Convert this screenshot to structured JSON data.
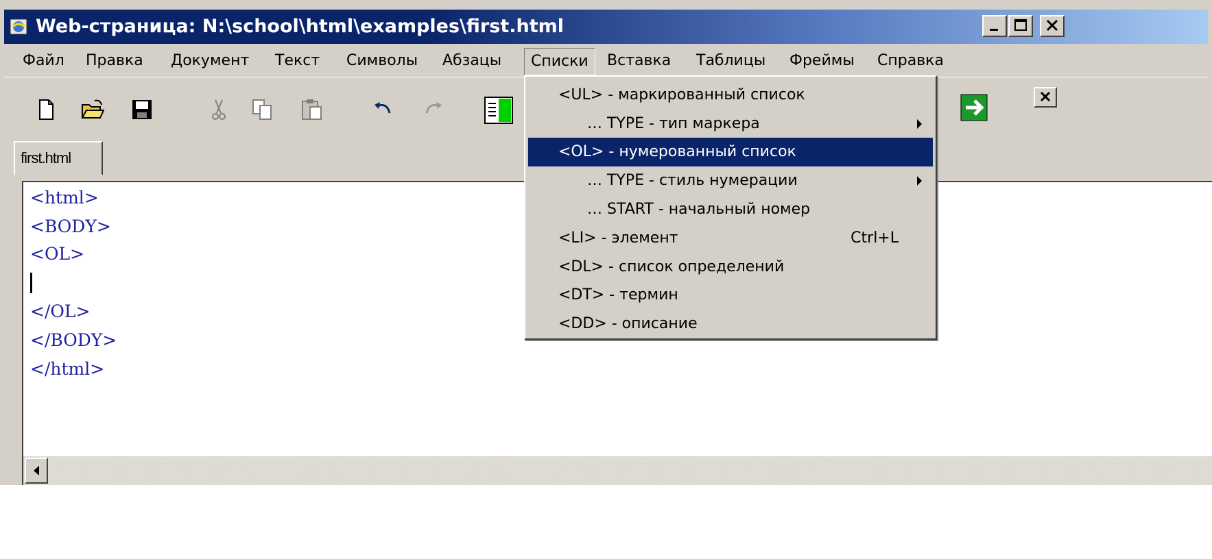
{
  "window": {
    "title": "Web-страница: N:\\school\\html\\examples\\first.html",
    "buttons": [
      "minimize",
      "maximize",
      "close"
    ]
  },
  "menubar": {
    "items": [
      "Файл",
      "Правка",
      "Документ",
      "Текст",
      "Символы",
      "Абзацы",
      "Списки",
      "Вставка",
      "Таблицы",
      "Фреймы",
      "Справка"
    ],
    "open_item": "Списки"
  },
  "toolbar": {
    "icons": [
      "new-file-icon",
      "open-folder-icon",
      "save-icon",
      "cut-icon",
      "copy-icon",
      "paste-icon",
      "undo-icon",
      "redo-icon",
      "view-mode-icon",
      "go-arrow-icon"
    ]
  },
  "tabs": [
    {
      "label": "first.html",
      "active": true
    }
  ],
  "editor": {
    "lines": [
      "<html>",
      "<BODY>",
      "<OL>",
      "",
      "</OL>",
      "</BODY>",
      "</html>"
    ],
    "caret_line": 4
  },
  "dropdown": {
    "items": [
      {
        "label": "<UL> - маркированный список",
        "indent": false,
        "submenu": false,
        "shortcut": "",
        "highlighted": false
      },
      {
        "label": "… TYPE - тип маркера",
        "indent": true,
        "submenu": true,
        "shortcut": "",
        "highlighted": false
      },
      {
        "label": "<OL> - нумерованный список",
        "indent": false,
        "submenu": false,
        "shortcut": "",
        "highlighted": true
      },
      {
        "label": "… TYPE - стиль нумерации",
        "indent": true,
        "submenu": true,
        "shortcut": "",
        "highlighted": false
      },
      {
        "label": "… START - начальный номер",
        "indent": true,
        "submenu": false,
        "shortcut": "",
        "highlighted": false
      },
      {
        "label": "<LI> - элемент",
        "indent": false,
        "submenu": false,
        "shortcut": "Ctrl+L",
        "highlighted": false
      },
      {
        "label": "<DL> - список определений",
        "indent": false,
        "submenu": false,
        "shortcut": "",
        "highlighted": false
      },
      {
        "label": "<DT> - термин",
        "indent": false,
        "submenu": false,
        "shortcut": "",
        "highlighted": false
      },
      {
        "label": "<DD> - описание",
        "indent": false,
        "submenu": false,
        "shortcut": "",
        "highlighted": false
      }
    ]
  },
  "colors": {
    "title_bar": "#0a246a",
    "chrome": "#d4d0c8",
    "code_text": "#2020a0",
    "highlight": "#0a246a"
  }
}
